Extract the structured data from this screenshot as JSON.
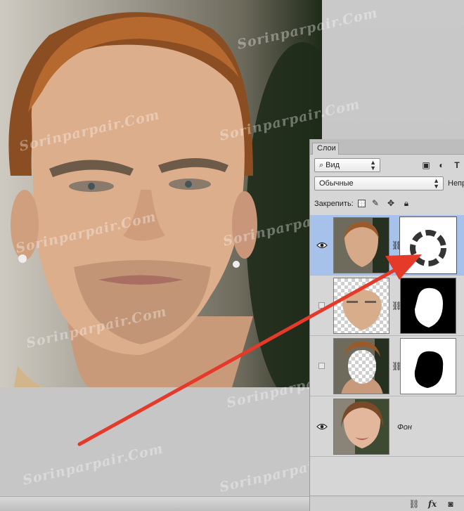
{
  "panel": {
    "tab_label": "Слои",
    "filter_label": "Вид",
    "blend_mode": "Обычные",
    "opacity_label_truncated": "Непр",
    "lock_label": "Закрепить:"
  },
  "layers": [
    {
      "name": "",
      "visible": true,
      "thumb": "face-swapped-photo",
      "mask": "ring-mask"
    },
    {
      "name": "",
      "visible": false,
      "thumb": "face-cutout",
      "mask": "face-white-mask"
    },
    {
      "name": "",
      "visible": false,
      "thumb": "head-with-face-hole",
      "mask": "face-black-mask"
    },
    {
      "name": "Фон",
      "visible": true,
      "thumb": "original-woman-photo",
      "mask": ""
    }
  ],
  "watermark_text": "Sorinparpair.Com",
  "colors": {
    "selected_row": "#a7c2ea",
    "arrow": "#e5392a"
  },
  "icons": {
    "filter": "search-icon",
    "lock_pixels": "checkerboard-lock-icon",
    "lock_brush": "brush-icon",
    "lock_position": "move-icon",
    "lock_all": "padlock-icon",
    "footer": [
      "link-icon",
      "fx-icon",
      "mask-icon"
    ]
  }
}
